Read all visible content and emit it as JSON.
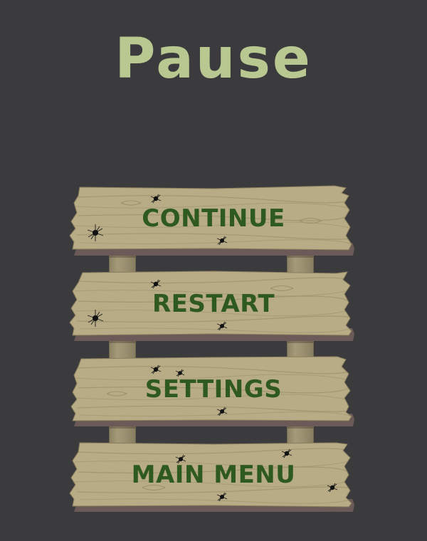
{
  "screen": {
    "title": "Pause",
    "background_color": "#3b3b3e",
    "title_color": "#b9c790",
    "label_color": "#2f5a1f"
  },
  "menu": {
    "items": [
      {
        "id": "continue",
        "label": "CONTINUE"
      },
      {
        "id": "restart",
        "label": "RESTART"
      },
      {
        "id": "settings",
        "label": "SETTINGS"
      },
      {
        "id": "main-menu",
        "label": "MAIN MENU"
      }
    ],
    "decoration": "bullet-hole-icon"
  }
}
